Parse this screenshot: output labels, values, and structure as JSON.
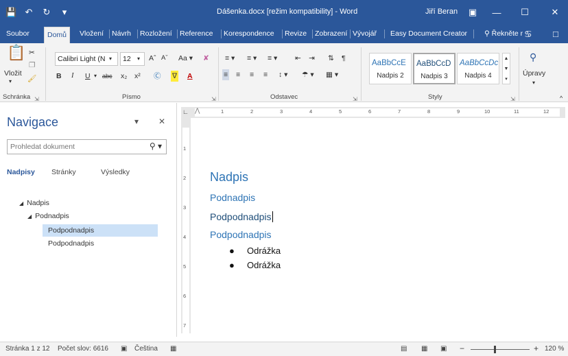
{
  "titlebar": {
    "document_title": "Dášenka.docx [režim kompatibility]  -  Word",
    "user_name": "Jiří Beran",
    "icons": [
      "save-icon",
      "undo-icon",
      "redo-icon",
      "customize-qat-icon",
      "ribbon-display-options-icon",
      "minimize-icon",
      "maximize-icon",
      "close-icon"
    ]
  },
  "menu": {
    "tabs": [
      "Soubor",
      "Domů",
      "Vložení",
      "Návrh",
      "Rozložení",
      "Reference",
      "Korespondence",
      "Revize",
      "Zobrazení",
      "Vývojář",
      "Easy Document Creator"
    ],
    "active_tab": "Domů",
    "tell_me": "Řekněte r"
  },
  "ribbon": {
    "clipboard": {
      "paste_label": "Vložit",
      "group_label": "Schránka"
    },
    "font": {
      "font_name": "Calibri Light (N",
      "font_size": "12",
      "case_label": "Aa",
      "group_label": "Písmo"
    },
    "paragraph": {
      "group_label": "Odstavec"
    },
    "styles": {
      "group_label": "Styly",
      "items": [
        {
          "sample": "AaBbCcE",
          "name": "Nadpis 2"
        },
        {
          "sample": "AaBbCcD",
          "name": "Nadpis 3"
        },
        {
          "sample": "AaBbCcDc",
          "name": "Nadpis 4"
        }
      ]
    },
    "editing": {
      "label": "Úpravy"
    }
  },
  "navigation": {
    "title": "Navigace",
    "search_placeholder": "Prohledat dokument",
    "tabs": [
      "Nadpisy",
      "Stránky",
      "Výsledky"
    ],
    "active_tab": "Nadpisy",
    "tree": [
      {
        "label": "Nadpis",
        "level": 0,
        "expanded": true
      },
      {
        "label": "Podnadpis",
        "level": 1,
        "expanded": true
      },
      {
        "label": "Podpodnadpis",
        "level": 2,
        "selected": true
      },
      {
        "label": "Podpodnadpis",
        "level": 2
      }
    ]
  },
  "ruler": {
    "h_numbers": [
      "1",
      "2",
      "3",
      "4",
      "5",
      "6",
      "7",
      "8",
      "9",
      "10",
      "11",
      "12"
    ],
    "v_numbers": [
      "1",
      "2",
      "3",
      "4",
      "5",
      "6",
      "7"
    ]
  },
  "document": {
    "heading1": "Nadpis",
    "heading2": "Podnadpis",
    "heading3a": "Podpodnadpis",
    "heading3b": "Podpodnadpis",
    "bullets": [
      "Odrážka",
      "Odrážka"
    ]
  },
  "statusbar": {
    "page": "Stránka 1 z 12",
    "words": "Počet slov: 6616",
    "language": "Čeština",
    "zoom": "120 %"
  },
  "colors": {
    "brand": "#2b579a",
    "heading": "#2e74b5",
    "selection": "#cce1f7"
  }
}
